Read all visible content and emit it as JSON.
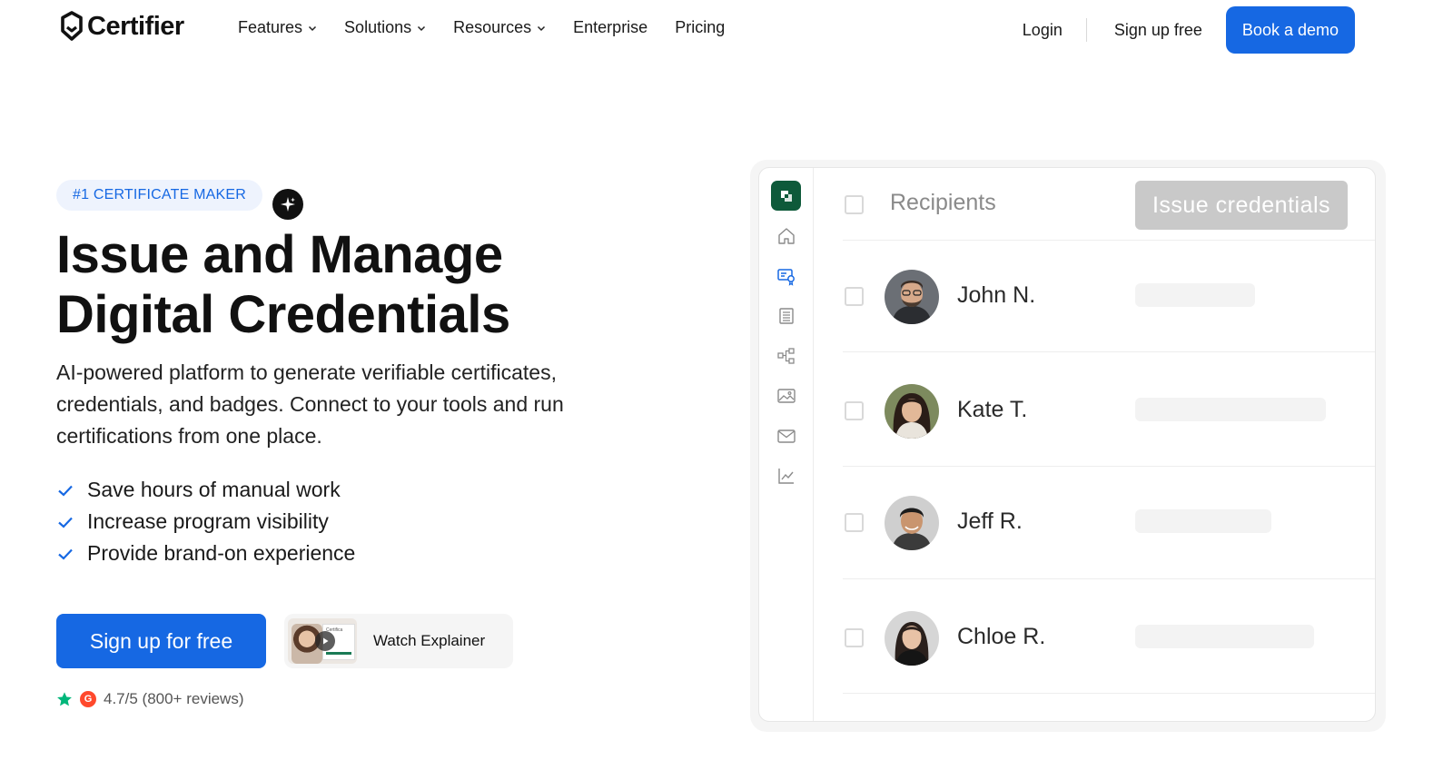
{
  "header": {
    "brand": "Certifier",
    "menu": [
      {
        "label": "Features",
        "has_dropdown": true
      },
      {
        "label": "Solutions",
        "has_dropdown": true
      },
      {
        "label": "Resources",
        "has_dropdown": true
      },
      {
        "label": "Enterprise",
        "has_dropdown": false
      },
      {
        "label": "Pricing",
        "has_dropdown": false
      }
    ],
    "login_label": "Login",
    "signup_label": "Sign up free",
    "demo_label": "Book a demo"
  },
  "hero": {
    "badge": "#1 CERTIFICATE MAKER",
    "headline_line1": "Issue and Manage",
    "headline_line2": "Digital Credentials",
    "subtext": "AI-powered platform to generate verifiable certificates, credentials, and badges. Connect to your tools and run certifications from one place.",
    "bullets": [
      "Save hours of manual work",
      "Increase program visibility",
      "Provide brand-on experience"
    ],
    "cta_label": "Sign up for free",
    "explainer_label": "Watch Explainer",
    "explainer_thumb_text": "Certifica",
    "rating_text": "4.7/5 (800+ reviews)",
    "rating_g2": "G"
  },
  "mockup": {
    "header_label": "Recipients",
    "issue_label": "Issue credentials",
    "sidebar_icons": [
      "home-icon",
      "credential-icon",
      "list-icon",
      "workflow-icon",
      "image-icon",
      "mail-icon",
      "analytics-icon"
    ],
    "recipients": [
      {
        "name": "John N."
      },
      {
        "name": "Kate T."
      },
      {
        "name": "Jeff R."
      },
      {
        "name": "Chloe R."
      }
    ]
  },
  "colors": {
    "accent": "#1668e3",
    "brand_green": "#0e5a3a",
    "check_blue": "#1668e3",
    "star_green": "#00b67a"
  }
}
